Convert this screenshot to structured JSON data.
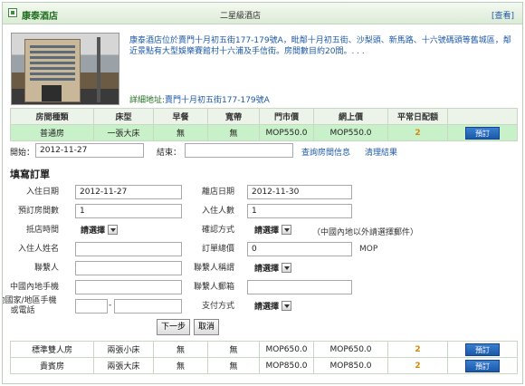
{
  "header": {
    "hotel_name": "康泰酒店",
    "star_rating": "二星級酒店",
    "view_link": "[查看]"
  },
  "hotel": {
    "description": "康泰酒店位於賣門十月初五街177-179號A，毗鄰十月初五街、沙梨頭、新馬路、十六號碼頭等舊城區，鄰近景點有大型娛樂賽館村十六浦及手信街。房間數目約20間。. . .",
    "address_label": "詳細地址:",
    "address": "賣門十月初五街177-179號A"
  },
  "rooms_table": {
    "headers": [
      "房間種類",
      "床型",
      "早餐",
      "寬帶",
      "門市價",
      "網上價",
      "平常日配額",
      ""
    ],
    "rows": [
      {
        "room": "普通房",
        "bed": "一張大床",
        "breakfast": "無",
        "broadband": "無",
        "rack": "MOP550.0",
        "online": "MOP550.0",
        "quota": "2",
        "book": "預訂"
      }
    ]
  },
  "filter": {
    "start_label": "開始：",
    "start_value": "2012-11-27",
    "end_label": "結束：",
    "end_value": "",
    "query_link": "查詢房間信息",
    "clear_link": "清理結果"
  },
  "booking_form": {
    "title": "填寫訂單",
    "checkin_label": "入住日期",
    "checkin_value": "2012-11-27",
    "checkout_label": "離店日期",
    "checkout_value": "2012-11-30",
    "rooms_label": "預訂房間數",
    "rooms_value": "1",
    "guests_label": "入住人數",
    "guests_value": "1",
    "arrival_label": "抵店時間",
    "arrival_value": "請選擇",
    "confirm_label": "確認方式",
    "confirm_value": "請選擇",
    "confirm_note": "（中國內地以外請選擇郵件）",
    "guest_name_label": "入住人姓名",
    "guest_name_value": "",
    "total_label": "訂單總價",
    "total_value": "0",
    "total_unit": "MOP",
    "contact_label": "聯繫人",
    "contact_value": "",
    "contact_title_label": "聯繫人稱謂",
    "contact_title_value": "請選擇",
    "mainland_phone_label": "中國內地手機",
    "mainland_phone_value": "",
    "contact_email_label": "聯繫人郵箱",
    "contact_email_value": "",
    "other_phone_label": "其他國家/地區手機或電話",
    "other_phone_code": "",
    "other_phone_number": "",
    "payment_label": "支付方式",
    "payment_value": "請選擇",
    "next_button": "下一步",
    "cancel_button": "取消"
  },
  "more_rooms": [
    {
      "room": "標準雙人房",
      "bed": "兩張小床",
      "breakfast": "無",
      "broadband": "無",
      "rack": "MOP650.0",
      "online": "MOP650.0",
      "quota": "2",
      "book": "預訂"
    },
    {
      "room": "貴賓房",
      "bed": "兩張大床",
      "breakfast": "無",
      "broadband": "無",
      "rack": "MOP850.0",
      "online": "MOP850.0",
      "quota": "2",
      "book": "預訂"
    }
  ],
  "colors": {
    "brand_green": "#1e6e1e",
    "link_blue": "#1e5aa8",
    "selected_row": "#c9f1c9",
    "quota_orange": "#d9870a",
    "book_button": "#1b58a8"
  }
}
